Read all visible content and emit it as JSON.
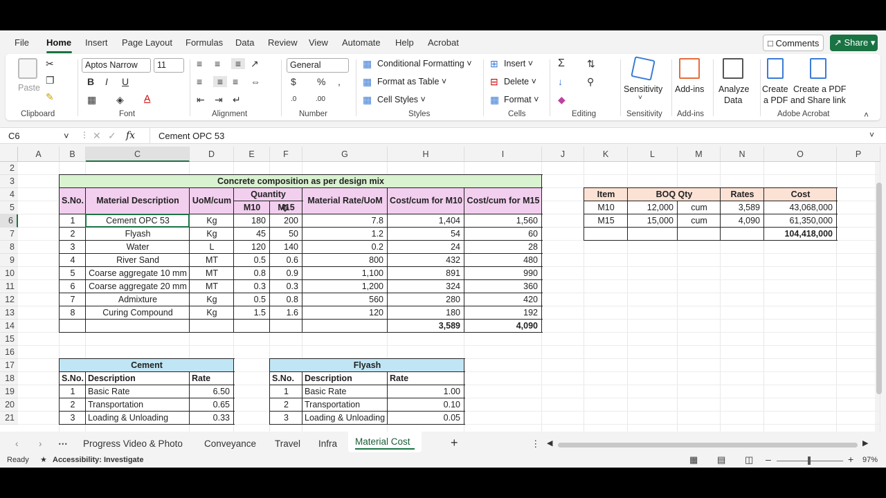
{
  "menu": {
    "items": [
      "File",
      "Home",
      "Insert",
      "Page Layout",
      "Formulas",
      "Data",
      "Review",
      "View",
      "Automate",
      "Help",
      "Acrobat"
    ],
    "comments": "Comments",
    "share": "Share"
  },
  "ribbon": {
    "paste": "Paste",
    "font_name": "Aptos Narrow",
    "font_size": "11",
    "number_format": "General",
    "conditional_formatting": "Conditional Formatting",
    "format_as_table": "Format as Table",
    "cell_styles": "Cell Styles",
    "insert": "Insert",
    "delete": "Delete",
    "format": "Format",
    "sensitivity": "Sensitivity",
    "addins": "Add-ins",
    "analyze_data_1": "Analyze",
    "analyze_data_2": "Data",
    "create_pdf_1": "Create",
    "create_pdf_2": "a PDF",
    "create_share_1": "Create a PDF",
    "create_share_2": "and Share link",
    "groups": {
      "clipboard": "Clipboard",
      "font": "Font",
      "alignment": "Alignment",
      "number": "Number",
      "styles": "Styles",
      "cells": "Cells",
      "editing": "Editing",
      "sensitivity": "Sensitivity",
      "addins": "Add-ins",
      "acrobat": "Adobe Acrobat"
    }
  },
  "formula_bar": {
    "name_box": "C6",
    "fx": "fx",
    "value": "Cement OPC 53"
  },
  "columns": [
    "A",
    "B",
    "C",
    "D",
    "E",
    "F",
    "G",
    "H",
    "I",
    "J",
    "K",
    "L",
    "M",
    "N",
    "O",
    "P"
  ],
  "rows": [
    "2",
    "3",
    "4",
    "5",
    "6",
    "7",
    "8",
    "9",
    "10",
    "11",
    "12",
    "13",
    "14",
    "15",
    "16",
    "17",
    "18",
    "19",
    "20",
    "21"
  ],
  "main_table": {
    "title": "Concrete composition as per design mix",
    "headers": {
      "sno": "S.No.",
      "desc": "Material Description",
      "uom": "UoM/cum",
      "qty": "Quantity",
      "m10": "M10",
      "m15": "M15",
      "rate": "Material Rate/UoM",
      "cost10": "Cost/cum for M10",
      "cost15": "Cost/cum for M15"
    },
    "rows": [
      {
        "sno": "1",
        "desc": "Cement OPC 53",
        "uom": "Kg",
        "m10": "180",
        "m15": "200",
        "rate": "7.8",
        "c10": "1,404",
        "c15": "1,560"
      },
      {
        "sno": "2",
        "desc": "Flyash",
        "uom": "Kg",
        "m10": "45",
        "m15": "50",
        "rate": "1.2",
        "c10": "54",
        "c15": "60"
      },
      {
        "sno": "3",
        "desc": "Water",
        "uom": "L",
        "m10": "120",
        "m15": "140",
        "rate": "0.2",
        "c10": "24",
        "c15": "28"
      },
      {
        "sno": "4",
        "desc": "River Sand",
        "uom": "MT",
        "m10": "0.5",
        "m15": "0.6",
        "rate": "800",
        "c10": "432",
        "c15": "480"
      },
      {
        "sno": "5",
        "desc": "Coarse aggregate 10 mm",
        "uom": "MT",
        "m10": "0.8",
        "m15": "0.9",
        "rate": "1,100",
        "c10": "891",
        "c15": "990"
      },
      {
        "sno": "6",
        "desc": "Coarse aggregate 20 mm",
        "uom": "MT",
        "m10": "0.3",
        "m15": "0.3",
        "rate": "1,200",
        "c10": "324",
        "c15": "360"
      },
      {
        "sno": "7",
        "desc": "Admixture",
        "uom": "Kg",
        "m10": "0.5",
        "m15": "0.8",
        "rate": "560",
        "c10": "280",
        "c15": "420"
      },
      {
        "sno": "8",
        "desc": "Curing Compound",
        "uom": "Kg",
        "m10": "1.5",
        "m15": "1.6",
        "rate": "120",
        "c10": "180",
        "c15": "192"
      }
    ],
    "total10": "3,589",
    "total15": "4,090"
  },
  "boq": {
    "headers": {
      "item": "Item",
      "qty": "BOQ Qty",
      "rates": "Rates",
      "cost": "Cost"
    },
    "rows": [
      {
        "item": "M10",
        "qty": "12,000",
        "unit": "cum",
        "rate": "3,589",
        "cost": "43,068,000"
      },
      {
        "item": "M15",
        "qty": "15,000",
        "unit": "cum",
        "rate": "4,090",
        "cost": "61,350,000"
      }
    ],
    "total": "104,418,000"
  },
  "cement": {
    "title": "Cement",
    "headers": {
      "sno": "S.No.",
      "desc": "Description",
      "rate": "Rate"
    },
    "rows": [
      {
        "sno": "1",
        "desc": "Basic Rate",
        "rate": "6.50"
      },
      {
        "sno": "2",
        "desc": "Transportation",
        "rate": "0.65"
      },
      {
        "sno": "3",
        "desc": "Loading & Unloading",
        "rate": "0.33"
      }
    ]
  },
  "flyash": {
    "title": "Flyash",
    "headers": {
      "sno": "S.No.",
      "desc": "Description",
      "rate": "Rate"
    },
    "rows": [
      {
        "sno": "1",
        "desc": "Basic Rate",
        "rate": "1.00"
      },
      {
        "sno": "2",
        "desc": "Transportation",
        "rate": "0.10"
      },
      {
        "sno": "3",
        "desc": "Loading & Unloading",
        "rate": "0.05"
      }
    ]
  },
  "sheets": [
    "Progress Video & Photo",
    "Conveyance",
    "Travel",
    "Infra",
    "Material Cost"
  ],
  "status": {
    "ready": "Ready",
    "accessibility": "Accessibility: Investigate",
    "zoom": "97%"
  },
  "colors": {
    "green": "#1a7343",
    "title_fill": "#d9f2d0",
    "pink_fill": "#f2cfee",
    "orange_fill": "#fbe2d5",
    "blue_fill": "#c0e6f5"
  }
}
